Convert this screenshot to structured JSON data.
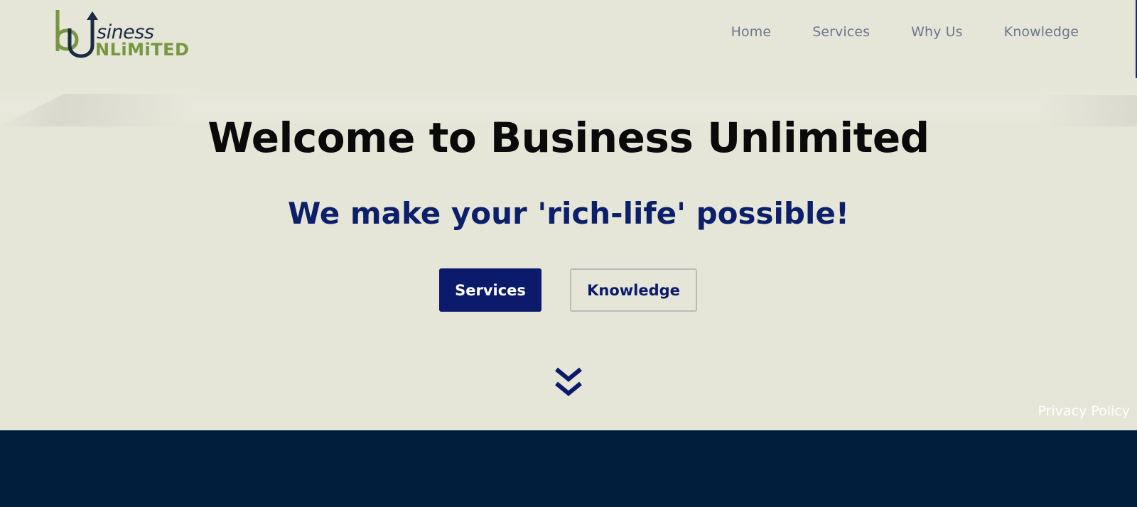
{
  "brand": {
    "logo_name": "Business Unlimited",
    "logo_top_text": "siness",
    "logo_bottom_text": "NLiMiTED",
    "logo_green": "#77963f",
    "logo_navy": "#1b2b44"
  },
  "nav": {
    "items": [
      "Home",
      "Services",
      "Why Us",
      "Knowledge"
    ]
  },
  "hero": {
    "title": "Welcome to Business Unlimited",
    "subtitle": "We make your 'rich-life' possible!",
    "primary_button": "Services",
    "secondary_button": "Knowledge",
    "scroll_icon": "double-chevron-down-icon"
  },
  "footer": {
    "privacy_link": "Privacy Policy"
  },
  "colors": {
    "background": "#e6e6d8",
    "accent_navy": "#0b1a6b",
    "nav_text": "#6b7790",
    "footer_band": "#001f3d"
  }
}
